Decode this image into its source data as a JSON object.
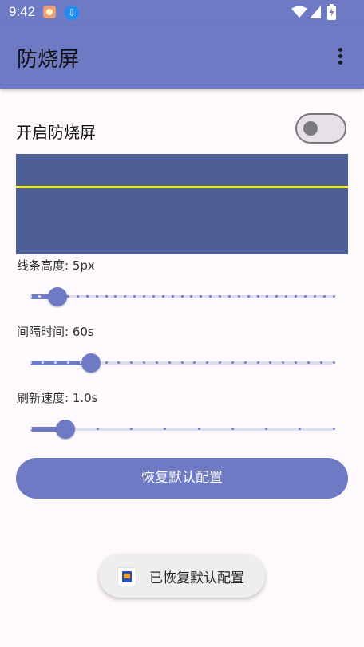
{
  "status_bar": {
    "time": "9:42",
    "notification_icons": [
      "app-notification-icon",
      "download-icon"
    ],
    "right_icons": [
      "wifi-icon",
      "cellular-signal-icon",
      "battery-charging-icon"
    ]
  },
  "app_bar": {
    "title": "防烧屏",
    "menu_icon": "more-vert-icon"
  },
  "settings": {
    "enable_label": "开启防烧屏",
    "enable_on": false,
    "preview_colors": {
      "background": "#4e5f96",
      "line": "#f1f20d"
    },
    "sliders": [
      {
        "label": "线条高度: 5px",
        "value_fraction": 0.09,
        "ticks": 32
      },
      {
        "label": "间隔时间: 60s",
        "value_fraction": 0.2,
        "ticks": 24
      },
      {
        "label": "刷新速度: 1.0s",
        "value_fraction": 0.115,
        "ticks": 9
      }
    ]
  },
  "actions": {
    "reset_label": "恢复默认配置"
  },
  "toast": {
    "message": "已恢复默认配置"
  },
  "colors": {
    "primary": "#6e7bc4",
    "background": "#fdf9fd",
    "track_inactive": "#dedcf0"
  }
}
